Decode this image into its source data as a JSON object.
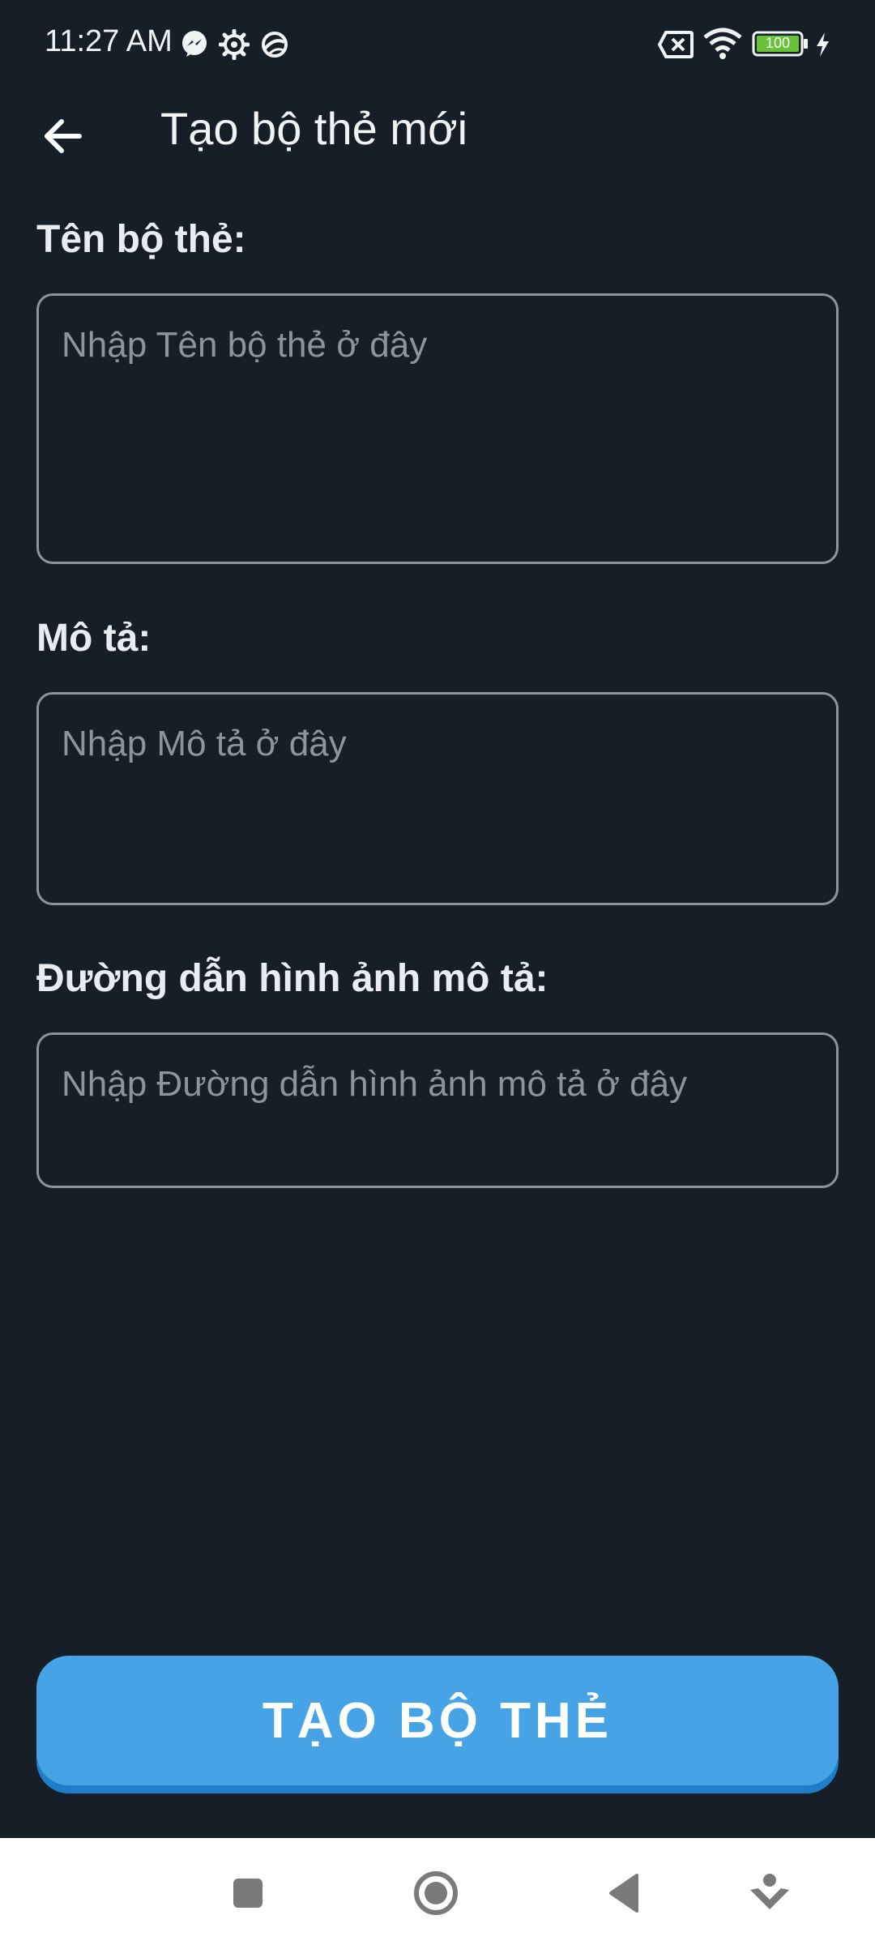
{
  "status_bar": {
    "time": "11:27 AM",
    "battery_level": "100",
    "icons": [
      "messenger-icon",
      "settings-gear-icon",
      "vpn-globe-icon",
      "no-sim-icon",
      "wifi-icon",
      "battery-icon",
      "charging-bolt-icon"
    ]
  },
  "app_bar": {
    "title": "Tạo bộ thẻ mới",
    "back_icon": "arrow-left-icon"
  },
  "form": {
    "name_label": "Tên bộ thẻ:",
    "name_placeholder": "Nhập Tên bộ thẻ ở đây",
    "name_value": "",
    "description_label": "Mô tả:",
    "description_placeholder": "Nhập Mô tả ở đây",
    "description_value": "",
    "image_label": "Đường dẫn hình ảnh mô tả:",
    "image_placeholder": "Nhập Đường dẫn hình ảnh mô tả ở đây",
    "image_value": ""
  },
  "actions": {
    "create_label": "TẠO BỘ THẺ"
  },
  "colors": {
    "background": "#161f27",
    "accent": "#45a3e6",
    "accent_shadow": "#1f7ec9",
    "border": "#8d949b",
    "battery_fill": "#67c23a"
  },
  "nav_bar": {
    "buttons": [
      "recents-square-icon",
      "home-circle-icon",
      "back-triangle-icon",
      "assistant-down-icon"
    ]
  }
}
